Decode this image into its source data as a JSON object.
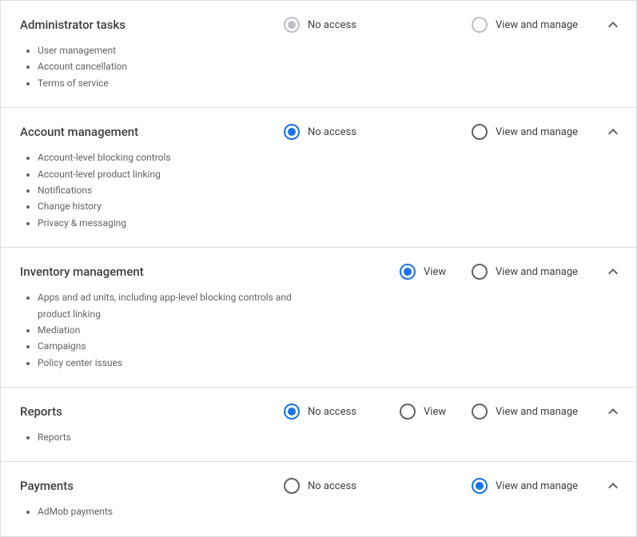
{
  "labels": {
    "no_access": "No access",
    "view": "View",
    "view_and_manage": "View and manage"
  },
  "sections": [
    {
      "title": "Administrator tasks",
      "items": [
        "User management",
        "Account cancellation",
        "Terms of service"
      ]
    },
    {
      "title": "Account management",
      "items": [
        "Account-level blocking controls",
        "Account-level product linking",
        "Notifications",
        "Change history",
        "Privacy & messaging"
      ]
    },
    {
      "title": "Inventory management",
      "items": [
        "Apps and ad units, including app-level blocking controls and product linking",
        "Mediation",
        "Campaigns",
        "Policy center issues"
      ]
    },
    {
      "title": "Reports",
      "items": [
        "Reports"
      ]
    },
    {
      "title": "Payments",
      "items": [
        "AdMob payments"
      ]
    }
  ]
}
